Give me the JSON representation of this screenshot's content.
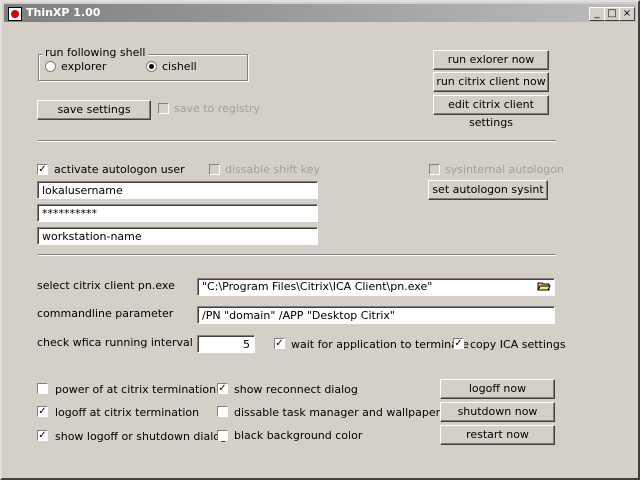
{
  "window": {
    "title": "ThinXP 1.00",
    "controls": {
      "minimize": "_",
      "maximize": "□",
      "close": "×"
    }
  },
  "shell": {
    "group_label": "run following shell",
    "options": [
      {
        "label": "explorer",
        "selected": false
      },
      {
        "label": "cishell",
        "selected": true
      }
    ]
  },
  "settings": {
    "save_label": "save settings",
    "save_registry_label": "save to registry",
    "save_registry_checked": false,
    "save_registry_enabled": false
  },
  "actions": {
    "run_explorer": "run exlorer now",
    "run_citrix": "run citrix client now",
    "edit_citrix": "edit citrix client settings"
  },
  "autologon": {
    "activate_label": "activate autologon user",
    "activate_checked": true,
    "disable_shift_label": "dissable shift key",
    "disable_shift_checked": false,
    "sysinternal_label": "sysinternal autologon",
    "sysinternal_checked": false,
    "set_sysint_label": "set autologon sysint",
    "username": "lokalusername",
    "password": "**********",
    "workstation": "workstation-name"
  },
  "citrix": {
    "client_label": "select citrix client pn.exe",
    "client_path": "\"C:\\Program Files\\Citrix\\ICA Client\\pn.exe\"",
    "browse_icon": "folder-open-icon",
    "params_label": "commandline parameter",
    "params_value": "/PN \"domain\" /APP \"Desktop Citrix\"",
    "interval_label": "check wfica running interval",
    "interval_value": "5",
    "wait_label": "wait for application to terminate",
    "wait_checked": true,
    "copy_ica_label": "copy ICA settings",
    "copy_ica_checked": true
  },
  "termination": {
    "power_off_label": "power of at citrix termination",
    "power_off_checked": false,
    "logoff_label": "logoff at citrix termination",
    "logoff_checked": true,
    "show_dialog_label": "show logoff or shutdown dialog",
    "show_dialog_checked": true,
    "reconnect_label": "show reconnect dialog",
    "reconnect_checked": true,
    "disable_taskmgr_label": "dissable task manager and wallpaper",
    "disable_taskmgr_checked": false,
    "black_bg_label": "black background color",
    "black_bg_checked": false
  },
  "power": {
    "logoff": "logoff now",
    "shutdown": "shutdown now",
    "restart": "restart now"
  }
}
